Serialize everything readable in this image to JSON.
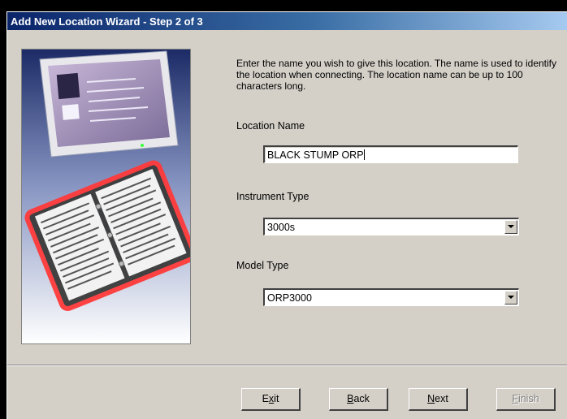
{
  "window": {
    "title": "Add New Location Wizard - Step 2 of 3"
  },
  "instructions": "Enter the name you wish to give this location. The name is used to identify the location when connecting.  The location name can be up to 100 characters long.",
  "fields": {
    "location_name": {
      "label": "Location Name",
      "value": "BLACK STUMP ORP"
    },
    "instrument_type": {
      "label": "Instrument Type",
      "value": "3000s"
    },
    "model_type": {
      "label": "Model Type",
      "value": "ORP3000"
    }
  },
  "buttons": {
    "exit": {
      "pre": "E",
      "accel": "x",
      "post": "it"
    },
    "back": {
      "pre": "",
      "accel": "B",
      "post": "ack"
    },
    "next": {
      "pre": "",
      "accel": "N",
      "post": "ext"
    },
    "finish": {
      "pre": "",
      "accel": "F",
      "post": "inish",
      "enabled": false
    }
  },
  "colors": {
    "titlebar_start": "#0a246a",
    "titlebar_end": "#a6caf0",
    "dialog_face": "#d4d0c8"
  }
}
